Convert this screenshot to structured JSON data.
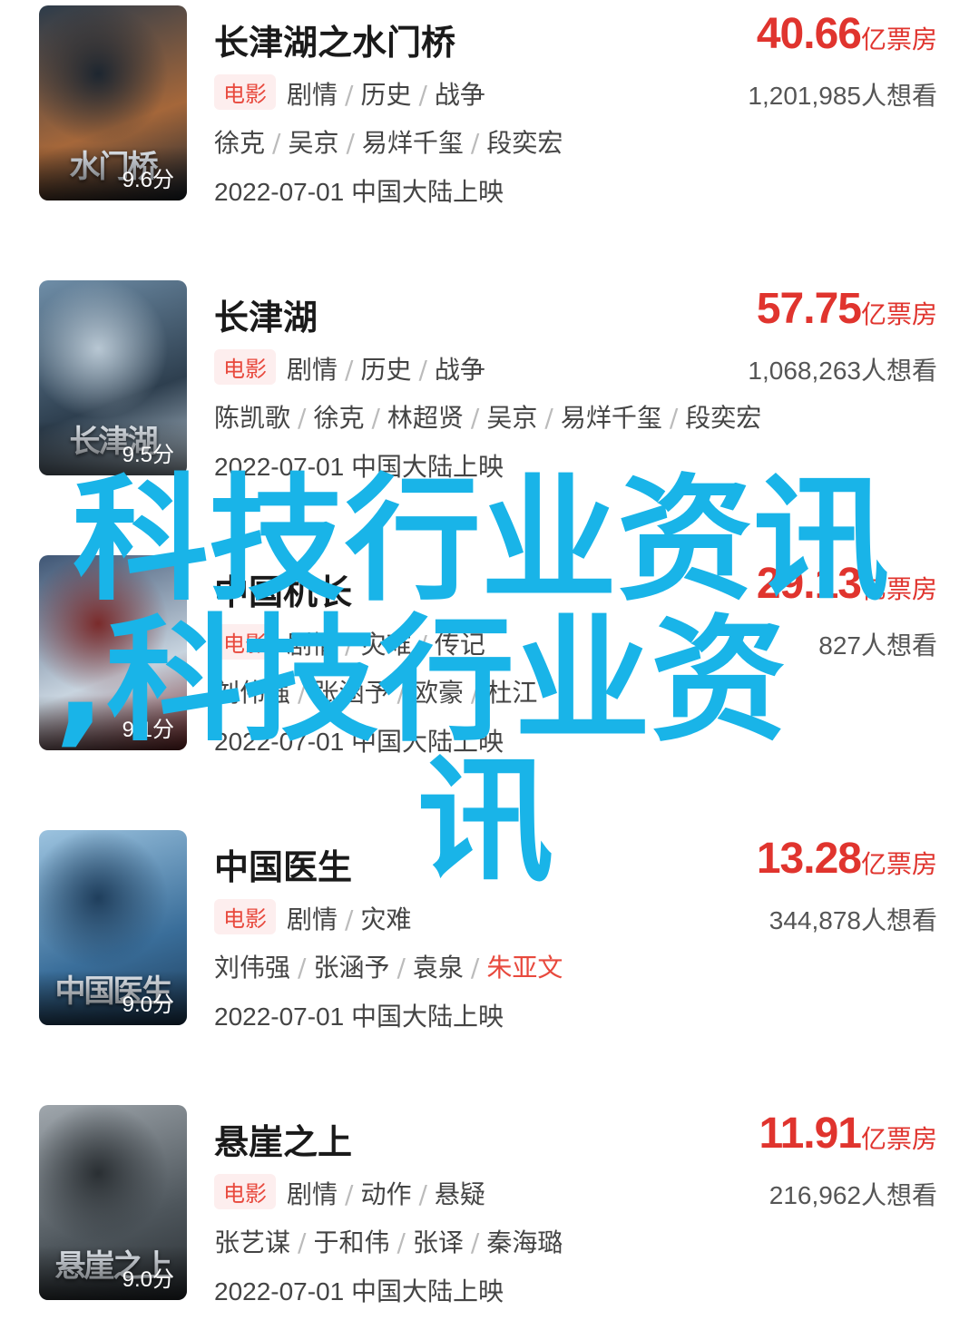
{
  "movies": [
    {
      "title": "长津湖之水门桥",
      "poster_title": "水门桥",
      "score": "9.6分",
      "tag": "电影",
      "genres": [
        "剧情",
        "历史",
        "战争"
      ],
      "box_value": "40.66",
      "box_unit": "亿票房",
      "want": "1,201,985人想看",
      "cast": [
        "徐克",
        "吴京",
        "易烊千玺",
        "段奕宏"
      ],
      "highlight_cast": "",
      "release_date": "2022-07-01",
      "release_text": "中国大陆上映",
      "poster_colors": [
        "#2c3b4a",
        "#a5673a",
        "#1d2630"
      ]
    },
    {
      "title": "长津湖",
      "poster_title": "长津湖",
      "score": "9.5分",
      "tag": "电影",
      "genres": [
        "剧情",
        "历史",
        "战争"
      ],
      "box_value": "57.75",
      "box_unit": "亿票房",
      "want": "1,068,263人想看",
      "cast": [
        "陈凯歌",
        "徐克",
        "林超贤",
        "吴京",
        "易烊千玺",
        "段奕宏"
      ],
      "highlight_cast": "",
      "release_date": "2022-07-01",
      "release_text": "中国大陆上映",
      "poster_colors": [
        "#6f8ea8",
        "#2e3f4f",
        "#b8c7d3"
      ]
    },
    {
      "title": "中国机长",
      "poster_title": "",
      "score": "9.1分",
      "tag": "电影",
      "genres": [
        "剧情",
        "灾难",
        "传记"
      ],
      "box_value": "29.13",
      "box_unit": "亿票房",
      "want": "827人想看",
      "cast": [
        "刘伟强",
        "张涵予",
        "欧豪",
        "杜江"
      ],
      "highlight_cast": "",
      "release_date": "2022-07-01",
      "release_text": "中国大陆上映",
      "poster_colors": [
        "#3f5675",
        "#c8d4df",
        "#7a2b2b"
      ]
    },
    {
      "title": "中国医生",
      "poster_title": "中国医生",
      "score": "9.0分",
      "tag": "电影",
      "genres": [
        "剧情",
        "灾难"
      ],
      "box_value": "13.28",
      "box_unit": "亿票房",
      "want": "344,878人想看",
      "cast": [
        "刘伟强",
        "张涵予",
        "袁泉",
        "朱亚文"
      ],
      "highlight_cast": "朱亚文",
      "release_date": "2022-07-01",
      "release_text": "中国大陆上映",
      "poster_colors": [
        "#9cc3df",
        "#3a6e9a",
        "#1f3e5c"
      ]
    },
    {
      "title": "悬崖之上",
      "poster_title": "悬崖之上",
      "score": "9.0分",
      "tag": "电影",
      "genres": [
        "剧情",
        "动作",
        "悬疑"
      ],
      "box_value": "11.91",
      "box_unit": "亿票房",
      "want": "216,962人想看",
      "cast": [
        "张艺谋",
        "于和伟",
        "张译",
        "秦海璐"
      ],
      "highlight_cast": "",
      "release_date": "2022-07-01",
      "release_text": "中国大陆上映",
      "poster_colors": [
        "#a0a7ad",
        "#4e565c",
        "#2a2f33"
      ]
    }
  ],
  "overlay": {
    "line1": "科技行业资讯",
    "line2": ",科技行业资",
    "line3": "讯",
    "color": "#19b4e8"
  },
  "colors": {
    "accent_red": "#e0342e",
    "tag_bg": "#fdeeee"
  }
}
